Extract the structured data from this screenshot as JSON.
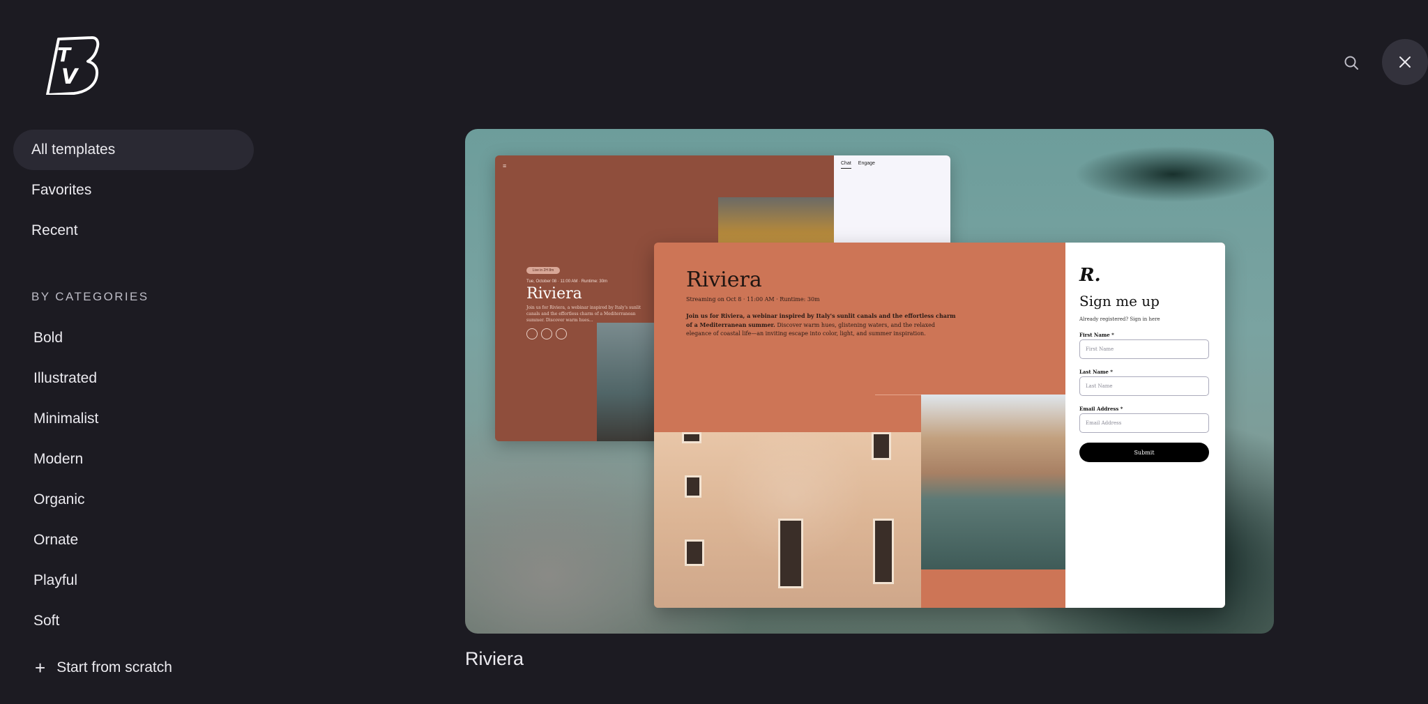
{
  "logo": {
    "text": "TVB"
  },
  "sidebar": {
    "nav": [
      {
        "label": "All templates",
        "active": true
      },
      {
        "label": "Favorites",
        "active": false
      },
      {
        "label": "Recent",
        "active": false
      }
    ],
    "categories_title": "BY CATEGORIES",
    "categories": [
      "Bold",
      "Illustrated",
      "Minimalist",
      "Modern",
      "Organic",
      "Ornate",
      "Playful",
      "Soft"
    ],
    "start_from_scratch": "Start from scratch"
  },
  "toolbar": {
    "search_icon": "search-icon",
    "close_icon": "close-icon"
  },
  "template": {
    "name": "Riviera",
    "preview": {
      "back": {
        "badge": "Live in 2H 8m",
        "meta": "Tue, October 08 · 11:00 AM · Runtime: 30m",
        "title": "Riviera",
        "desc": "Join us for Riviera, a webinar inspired by Italy's sunlit canals and the effortless charm of a Mediterranean summer. Discover warm hues...",
        "chat_tab": "Chat",
        "engage_tab": "Engage"
      },
      "front": {
        "title": "Riviera",
        "meta": "Streaming on Oct 8 · 11:00 AM · Runtime: 30m",
        "desc_bold": "Join us for Riviera, a webinar inspired by Italy's sunlit canals and the effortless charm of a Mediterranean summer.",
        "desc_rest": " Discover warm hues, glistening waters, and the relaxed elegance of coastal life—an inviting escape into color, light, and summer inspiration.",
        "form": {
          "logo": "R.",
          "heading": "Sign me up",
          "sub": "Already registered? Sign in here",
          "first_label": "First Name *",
          "first_placeholder": "First Name",
          "last_label": "Last Name *",
          "last_placeholder": "Last Name",
          "email_label": "Email Address *",
          "email_placeholder": "Email Address",
          "submit": "Submit"
        }
      }
    }
  }
}
